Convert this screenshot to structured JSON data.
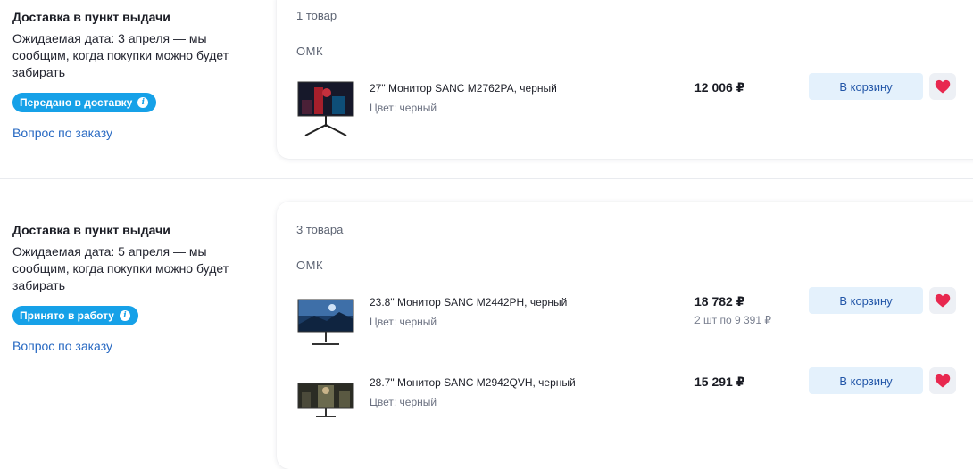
{
  "orders": [
    {
      "delivery_title": "Доставка в пункт выдачи",
      "expected": "Ожидаемая дата: 3 апреля — мы сообщим, когда покупки можно будет забирать",
      "status": "Передано в доставку",
      "question": "Вопрос по заказу",
      "count": "1 товар",
      "seller": "ОМК",
      "items": [
        {
          "name": "27\" Монитор SANC M2762PA, черный",
          "color": "Цвет: черный",
          "price": "12 006 ₽",
          "price_sub": "",
          "cart": "В корзину"
        }
      ]
    },
    {
      "delivery_title": "Доставка в пункт выдачи",
      "expected": "Ожидаемая дата: 5 апреля — мы сообщим, когда покупки можно будет забирать",
      "status": "Принято в работу",
      "question": "Вопрос по заказу",
      "count": "3 товара",
      "seller": "ОМК",
      "items": [
        {
          "name": "23.8\" Монитор SANC M2442PH, черный",
          "color": "Цвет: черный",
          "price": "18 782 ₽",
          "price_sub": "2 шт по 9 391 ₽",
          "cart": "В корзину"
        },
        {
          "name": "28.7\" Монитор SANC M2942QVH, черный",
          "color": "Цвет: черный",
          "price": "15 291 ₽",
          "price_sub": "",
          "cart": "В корзину"
        }
      ]
    }
  ],
  "colors": {
    "badge": "#16a1e8",
    "link": "#2668c2",
    "cart_button_bg": "#e4f1fc",
    "heart": "#e8284f"
  },
  "icons": {
    "info": "info-icon",
    "favorite": "heart-icon",
    "thumbnail": "monitor-thumbnail"
  }
}
